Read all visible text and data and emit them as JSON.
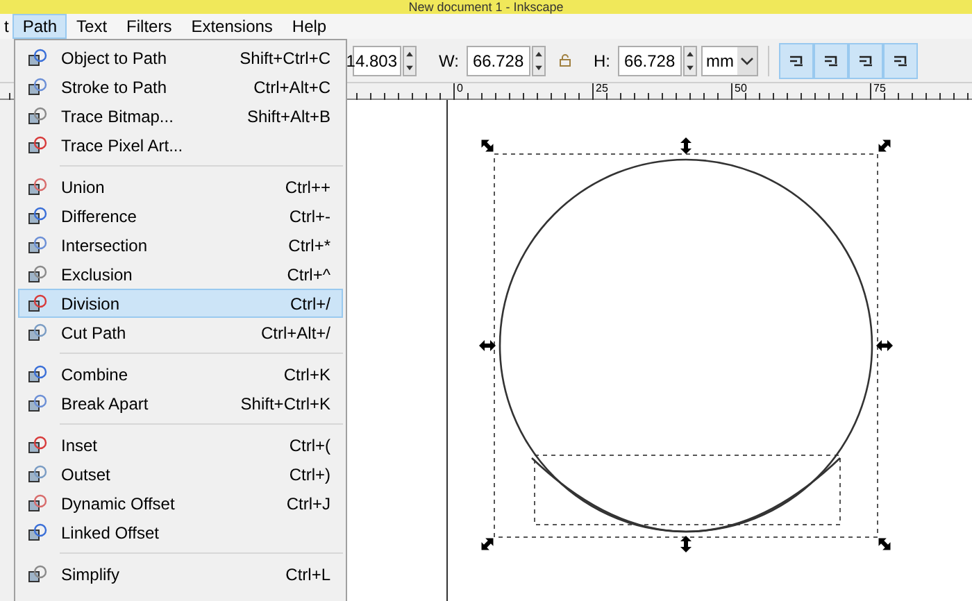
{
  "window": {
    "title": "New document 1 - Inkscape"
  },
  "menubar": [
    {
      "label": "t",
      "selected": false
    },
    {
      "label": "Path",
      "selected": true
    },
    {
      "label": "Text",
      "selected": false
    },
    {
      "label": "Filters",
      "selected": false
    },
    {
      "label": "Extensions",
      "selected": false
    },
    {
      "label": "Help",
      "selected": false
    }
  ],
  "toolbar": {
    "y_value": "14.803",
    "w_label": "W:",
    "w_value": "66.728",
    "h_label": "H:",
    "h_value": "66.728",
    "unit": "mm"
  },
  "ruler": {
    "labels": [
      "0",
      "25",
      "50",
      "75"
    ]
  },
  "path_menu": [
    {
      "kind": "item",
      "label": "Object to Path",
      "shortcut": "Shift+Ctrl+C",
      "selected": false
    },
    {
      "kind": "item",
      "label": "Stroke to Path",
      "shortcut": "Ctrl+Alt+C",
      "selected": false
    },
    {
      "kind": "item",
      "label": "Trace Bitmap...",
      "shortcut": "Shift+Alt+B",
      "selected": false
    },
    {
      "kind": "item",
      "label": "Trace Pixel Art...",
      "selected": false
    },
    {
      "kind": "separator"
    },
    {
      "kind": "item",
      "label": "Union",
      "shortcut": "Ctrl++",
      "selected": false
    },
    {
      "kind": "item",
      "label": "Difference",
      "shortcut": "Ctrl+-",
      "selected": false
    },
    {
      "kind": "item",
      "label": "Intersection",
      "shortcut": "Ctrl+*",
      "selected": false
    },
    {
      "kind": "item",
      "label": "Exclusion",
      "shortcut": "Ctrl+^",
      "selected": false
    },
    {
      "kind": "item",
      "label": "Division",
      "shortcut": "Ctrl+/",
      "selected": true
    },
    {
      "kind": "item",
      "label": "Cut Path",
      "shortcut": "Ctrl+Alt+/",
      "selected": false
    },
    {
      "kind": "separator"
    },
    {
      "kind": "item",
      "label": "Combine",
      "shortcut": "Ctrl+K",
      "selected": false
    },
    {
      "kind": "item",
      "label": "Break Apart",
      "shortcut": "Shift+Ctrl+K",
      "selected": false
    },
    {
      "kind": "separator"
    },
    {
      "kind": "item",
      "label": "Inset",
      "shortcut": "Ctrl+(",
      "selected": false
    },
    {
      "kind": "item",
      "label": "Outset",
      "shortcut": "Ctrl+)",
      "selected": false
    },
    {
      "kind": "item",
      "label": "Dynamic Offset",
      "shortcut": "Ctrl+J",
      "selected": false
    },
    {
      "kind": "item",
      "label": "Linked Offset",
      "selected": false
    },
    {
      "kind": "separator"
    },
    {
      "kind": "item",
      "label": "Simplify",
      "shortcut": "Ctrl+L",
      "selected": false
    }
  ]
}
